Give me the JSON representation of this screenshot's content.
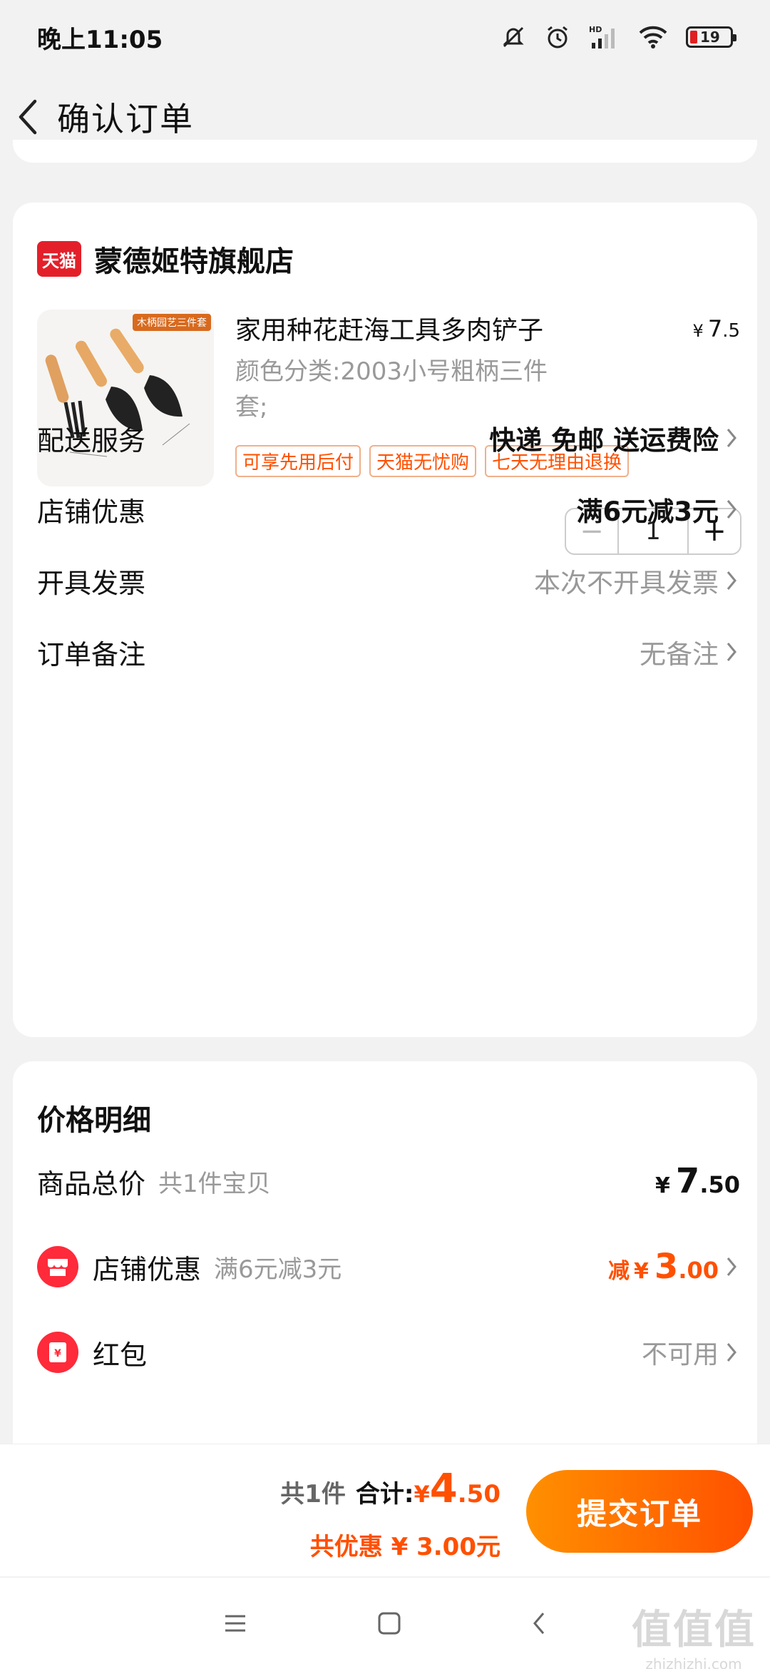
{
  "status_bar": {
    "time": "晚上11:05",
    "extra": "",
    "battery": "19"
  },
  "header": {
    "title": "确认订单"
  },
  "shop": {
    "badge": "天猫",
    "name": "蒙德姬特旗舰店",
    "product": {
      "image_tag": "木柄园艺三件套",
      "title": "家用种花赶海工具多肉铲子",
      "price_yen": "¥",
      "price_int": "7",
      "price_dec": ".5",
      "spec_line1": "颜色分类:2003小号粗柄三件",
      "spec_line2": "套;",
      "tags": [
        "可享先用后付",
        "天猫无忧购",
        "七天无理由退换"
      ],
      "quantity": "1",
      "minus": "−",
      "plus": "+"
    },
    "rows": {
      "delivery": {
        "label": "配送服务",
        "value": "快递 免邮 送运费险"
      },
      "discount": {
        "label": "店铺优惠",
        "value": "满6元减3元"
      },
      "invoice": {
        "label": "开具发票",
        "value": "本次不开具发票"
      },
      "note": {
        "label": "订单备注",
        "value": "无备注"
      }
    }
  },
  "price_detail": {
    "title": "价格明细",
    "goods_total": {
      "label": "商品总价",
      "sub": "共1件宝贝",
      "yen": "¥",
      "int": "7",
      "dec": ".50"
    },
    "shop_discount": {
      "label": "店铺优惠",
      "sub": "满6元减3元",
      "pre": "减",
      "yen": "¥",
      "int": "3",
      "dec": ".00"
    },
    "red_packet": {
      "label": "红包",
      "value": "不可用"
    }
  },
  "footer": {
    "count": "共1件",
    "total_label": "合计:",
    "total_yen": "¥",
    "total_int": "4",
    "total_dec": ".50",
    "saved": "共优惠 ¥ 3.00元",
    "submit": "提交订单"
  },
  "watermark": {
    "big": "值值值",
    "small": "zhizhizhi.com"
  },
  "colors": {
    "accent": "#ff5000",
    "tmall_red": "#e3202a",
    "button_gradient_start": "#ff9000"
  }
}
